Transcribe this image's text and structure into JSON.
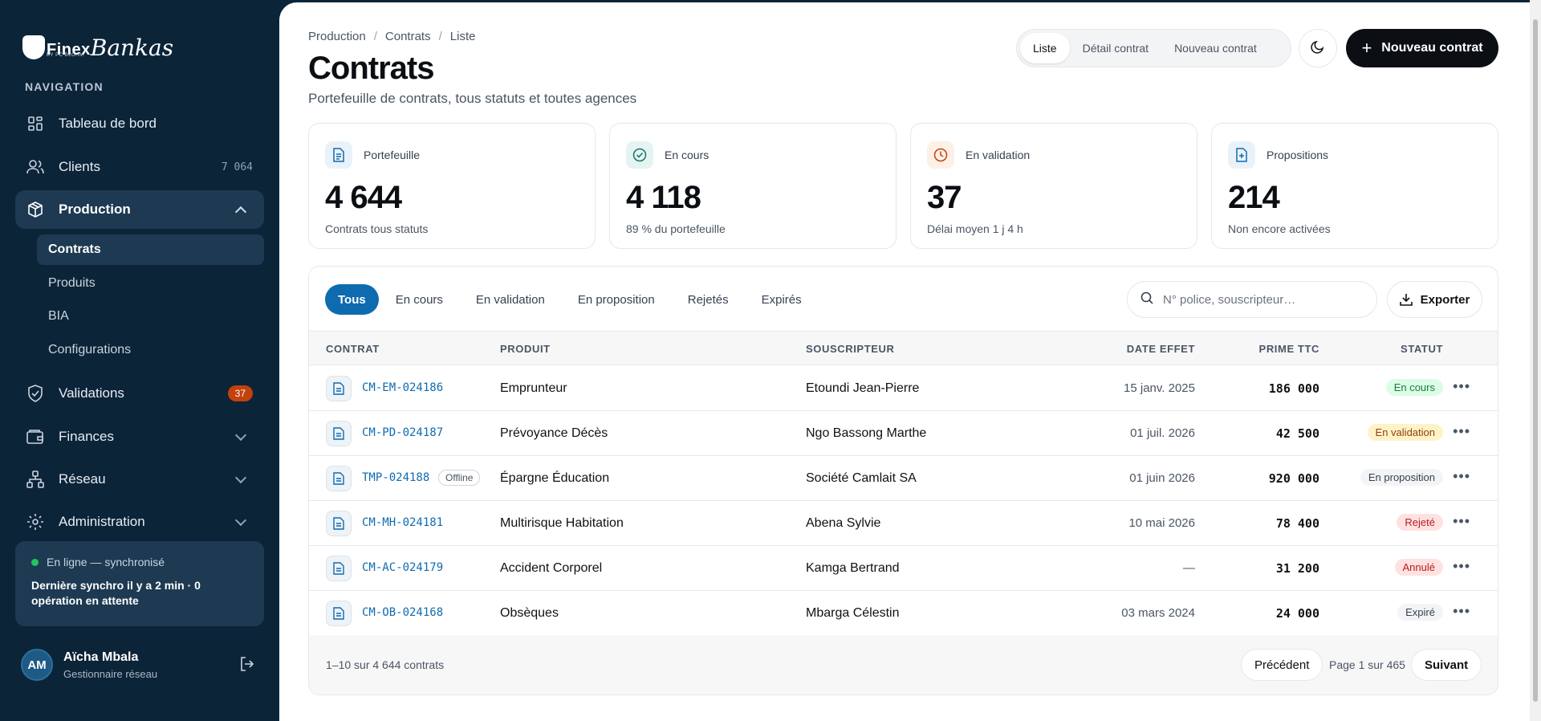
{
  "brand": {
    "name": "Finex",
    "script": "Bankas",
    "tagline": "BY PC BLOHM"
  },
  "nav": {
    "heading": "NAVIGATION",
    "items": [
      {
        "label": "Tableau de bord"
      },
      {
        "label": "Clients",
        "count": "7 064"
      },
      {
        "label": "Production"
      },
      {
        "label": "Validations",
        "badge": "37"
      },
      {
        "label": "Finances"
      },
      {
        "label": "Réseau"
      },
      {
        "label": "Administration"
      }
    ],
    "production_sub": [
      "Contrats",
      "Produits",
      "BIA",
      "Configurations"
    ]
  },
  "sync": {
    "status": "En ligne — synchronisé",
    "detail": "Dernière synchro il y a 2 min · 0 opération en attente"
  },
  "user": {
    "initials": "AM",
    "name": "Aïcha Mbala",
    "role": "Gestionnaire réseau"
  },
  "header": {
    "breadcrumb": [
      "Production",
      "Contrats",
      "Liste"
    ],
    "title": "Contrats",
    "subtitle": "Portefeuille de contrats, tous statuts et toutes agences",
    "views": [
      "Liste",
      "Détail contrat",
      "Nouveau contrat"
    ],
    "new_button": "Nouveau contrat"
  },
  "stats": [
    {
      "label": "Portefeuille",
      "value": "4 644",
      "note": "Contrats tous statuts",
      "icon": "document-icon",
      "color": "#0f6bb0"
    },
    {
      "label": "En cours",
      "value": "4 118",
      "note": "89 % du portefeuille",
      "icon": "check-circle-icon",
      "color": "#0f766e"
    },
    {
      "label": "En validation",
      "value": "37",
      "note": "Délai moyen 1 j 4 h",
      "icon": "clock-icon",
      "color": "#c2410c"
    },
    {
      "label": "Propositions",
      "value": "214",
      "note": "Non encore activées",
      "icon": "file-plus-icon",
      "color": "#0f6bb0"
    }
  ],
  "filters": {
    "tabs": [
      "Tous",
      "En cours",
      "En validation",
      "En proposition",
      "Rejetés",
      "Expirés"
    ],
    "search_placeholder": "N° police, souscripteur…",
    "export_label": "Exporter"
  },
  "table": {
    "columns": [
      "CONTRAT",
      "PRODUIT",
      "SOUSCRIPTEUR",
      "DATE EFFET",
      "PRIME TTC",
      "STATUT"
    ],
    "rows": [
      {
        "code": "CM-EM-024186",
        "produit": "Emprunteur",
        "souscripteur": "Etoundi Jean-Pierre",
        "date": "15 janv. 2025",
        "prime": "186 000",
        "statut": "En cours",
        "cls": "st-encours"
      },
      {
        "code": "CM-PD-024187",
        "produit": "Prévoyance Décès",
        "souscripteur": "Ngo Bassong Marthe",
        "date": "01 juil. 2026",
        "prime": "42 500",
        "statut": "En validation",
        "cls": "st-validation"
      },
      {
        "code": "TMP-024188",
        "offline": "Offline",
        "produit": "Épargne Éducation",
        "souscripteur": "Société Camlait SA",
        "date": "01 juin 2026",
        "prime": "920 000",
        "statut": "En proposition",
        "cls": "st-proposition"
      },
      {
        "code": "CM-MH-024181",
        "produit": "Multirisque Habitation",
        "souscripteur": "Abena Sylvie",
        "date": "10 mai 2026",
        "prime": "78 400",
        "statut": "Rejeté",
        "cls": "st-rejete"
      },
      {
        "code": "CM-AC-024179",
        "produit": "Accident Corporel",
        "souscripteur": "Kamga Bertrand",
        "date": "—",
        "prime": "31 200",
        "statut": "Annulé",
        "cls": "st-annule"
      },
      {
        "code": "CM-OB-024168",
        "produit": "Obsèques",
        "souscripteur": "Mbarga Célestin",
        "date": "03 mars 2024",
        "prime": "24 000",
        "statut": "Expiré",
        "cls": "st-expire"
      }
    ]
  },
  "pagination": {
    "count": "1–10 sur 4 644 contrats",
    "prev": "Précédent",
    "page": "Page 1 sur 465",
    "next": "Suivant"
  }
}
